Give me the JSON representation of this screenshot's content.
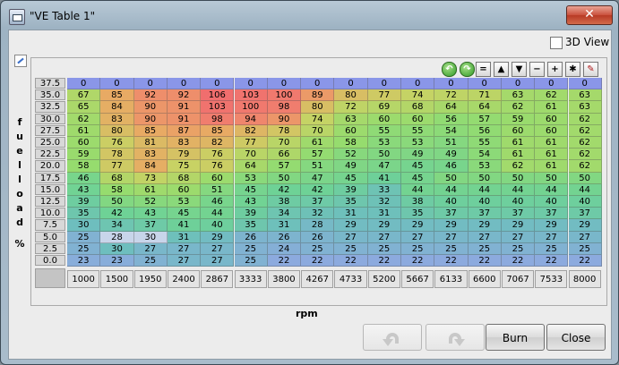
{
  "window": {
    "title": "\"VE Table 1\"",
    "close_glyph": "✕"
  },
  "options": {
    "view3d_label": "3D View",
    "view3d_checked": false
  },
  "toolbar": {
    "buttons": [
      {
        "name": "rotate-left-icon",
        "glyph": "↶",
        "style": "green"
      },
      {
        "name": "rotate-right-icon",
        "glyph": "↷",
        "style": "green"
      },
      {
        "name": "set-equal-icon",
        "glyph": "=",
        "style": "plain"
      },
      {
        "name": "increment-icon",
        "glyph": "▲",
        "style": "plain"
      },
      {
        "name": "decrement-icon",
        "glyph": "▼",
        "style": "plain"
      },
      {
        "name": "minus-icon",
        "glyph": "−",
        "style": "plain"
      },
      {
        "name": "plus-icon",
        "glyph": "+",
        "style": "plain"
      },
      {
        "name": "multiply-icon",
        "glyph": "✱",
        "style": "plain"
      },
      {
        "name": "interpolate-pen-icon",
        "glyph": "✎",
        "style": "pen"
      }
    ]
  },
  "axes": {
    "y_title_chars": [
      "f",
      "u",
      "e",
      "l",
      "l",
      "o",
      "a",
      "d",
      "",
      "%"
    ],
    "x_title": "rpm"
  },
  "table": {
    "y_axis": [
      "37.5",
      "35.0",
      "32.5",
      "30.0",
      "27.5",
      "25.0",
      "22.5",
      "20.0",
      "17.5",
      "15.0",
      "12.5",
      "10.0",
      "7.5",
      "5.0",
      "2.5",
      "0.0"
    ],
    "x_axis": [
      "1000",
      "1500",
      "1950",
      "2400",
      "2867",
      "3333",
      "3800",
      "4267",
      "4733",
      "5200",
      "5667",
      "6133",
      "6600",
      "7067",
      "7533",
      "8000"
    ],
    "rows": [
      [
        0,
        0,
        0,
        0,
        0,
        0,
        0,
        0,
        0,
        0,
        0,
        0,
        0,
        0,
        0,
        0
      ],
      [
        67,
        85,
        92,
        92,
        106,
        103,
        100,
        89,
        80,
        77,
        74,
        72,
        71,
        63,
        62,
        63
      ],
      [
        65,
        84,
        90,
        91,
        103,
        100,
        98,
        80,
        72,
        69,
        68,
        64,
        64,
        62,
        61,
        63
      ],
      [
        62,
        83,
        90,
        91,
        98,
        94,
        90,
        74,
        63,
        60,
        60,
        56,
        57,
        59,
        60,
        62
      ],
      [
        61,
        80,
        85,
        87,
        85,
        82,
        78,
        70,
        60,
        55,
        55,
        54,
        56,
        60,
        60,
        62
      ],
      [
        60,
        76,
        81,
        83,
        82,
        77,
        70,
        61,
        58,
        53,
        53,
        51,
        55,
        61,
        61,
        62
      ],
      [
        59,
        78,
        83,
        79,
        76,
        70,
        66,
        57,
        52,
        50,
        49,
        49,
        54,
        61,
        61,
        62
      ],
      [
        58,
        77,
        84,
        75,
        76,
        64,
        57,
        51,
        49,
        47,
        45,
        46,
        53,
        62,
        61,
        62
      ],
      [
        46,
        68,
        73,
        68,
        60,
        53,
        50,
        47,
        45,
        41,
        45,
        50,
        50,
        50,
        50,
        50
      ],
      [
        43,
        58,
        61,
        60,
        51,
        45,
        42,
        42,
        39,
        33,
        44,
        44,
        44,
        44,
        44,
        44
      ],
      [
        39,
        50,
        52,
        53,
        46,
        43,
        38,
        37,
        35,
        32,
        38,
        40,
        40,
        40,
        40,
        40
      ],
      [
        35,
        42,
        43,
        45,
        44,
        39,
        34,
        32,
        31,
        31,
        35,
        37,
        37,
        37,
        37,
        37
      ],
      [
        30,
        34,
        37,
        41,
        40,
        35,
        31,
        28,
        29,
        29,
        29,
        29,
        29,
        29,
        29,
        29
      ],
      [
        25,
        28,
        30,
        31,
        29,
        26,
        26,
        26,
        27,
        27,
        27,
        27,
        27,
        27,
        27,
        27
      ],
      [
        25,
        30,
        27,
        27,
        27,
        25,
        24,
        25,
        25,
        25,
        25,
        25,
        25,
        25,
        25,
        25
      ],
      [
        23,
        23,
        25,
        27,
        27,
        25,
        22,
        22,
        22,
        22,
        22,
        22,
        22,
        22,
        22,
        22
      ]
    ],
    "selected_cells": [
      [
        13,
        1
      ],
      [
        13,
        2
      ]
    ]
  },
  "buttons": {
    "undo_label": "",
    "redo_label": "",
    "burn_label": "Burn",
    "close_label": "Close"
  }
}
